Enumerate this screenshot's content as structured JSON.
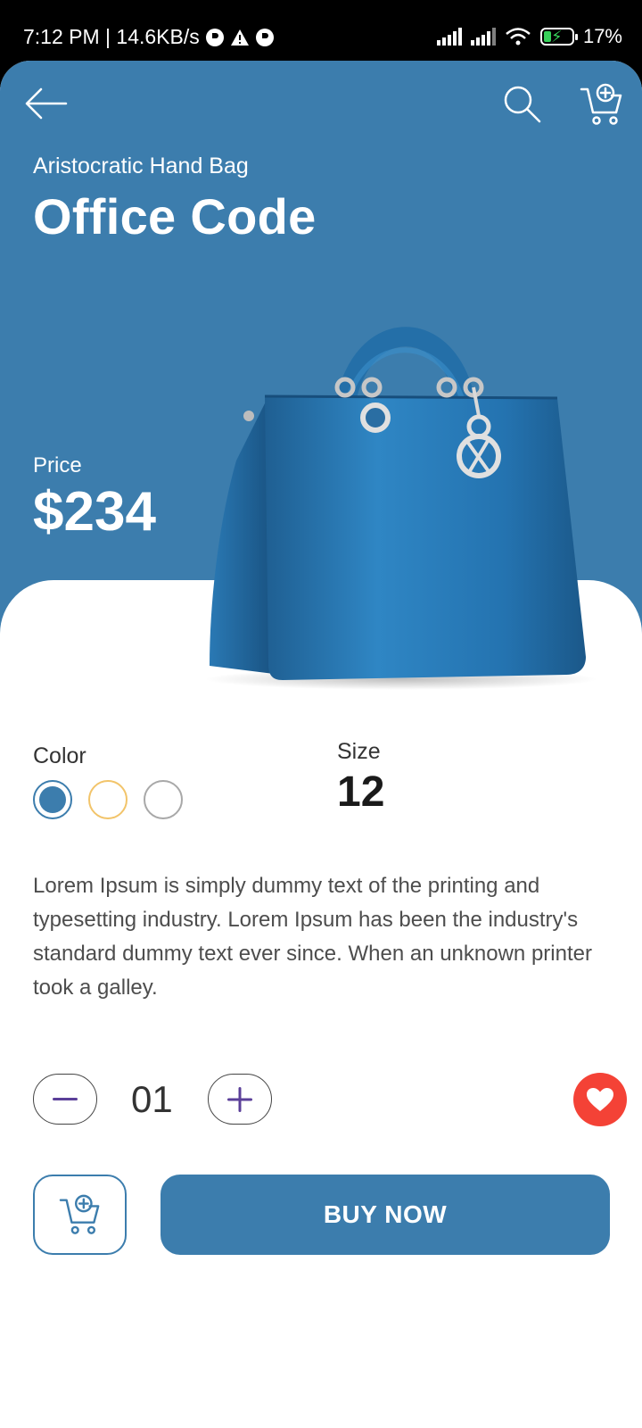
{
  "status_bar": {
    "time_speed": "7:12 PM | 14.6KB/s",
    "battery": "17%"
  },
  "header": {
    "back_icon": "arrow-left-icon",
    "search_icon": "search-icon",
    "cart_icon": "cart-add-icon"
  },
  "product": {
    "subtitle": "Aristocratic Hand Bag",
    "name": "Office Code",
    "price_label": "Price",
    "price": "$234",
    "image": "blue-handbag-image"
  },
  "options": {
    "color_label": "Color",
    "colors": [
      "#3c7dad",
      "#f2c46a",
      "#a8a8a8"
    ],
    "selected_color": "#3c7dad",
    "size_label": "Size",
    "size_value": "12"
  },
  "description": "Lorem Ipsum is simply dummy text of the printing and typesetting industry. Lorem Ipsum has been the industry's standard dummy text ever since. When an unknown printer took a galley.",
  "quantity": {
    "value": "01"
  },
  "actions": {
    "buy_label": "BUY NOW",
    "favorite_icon": "heart-icon"
  },
  "colors": {
    "primary": "#3c7dad",
    "favorite": "#f44236",
    "quantity_symbol": "#5b3f99"
  }
}
